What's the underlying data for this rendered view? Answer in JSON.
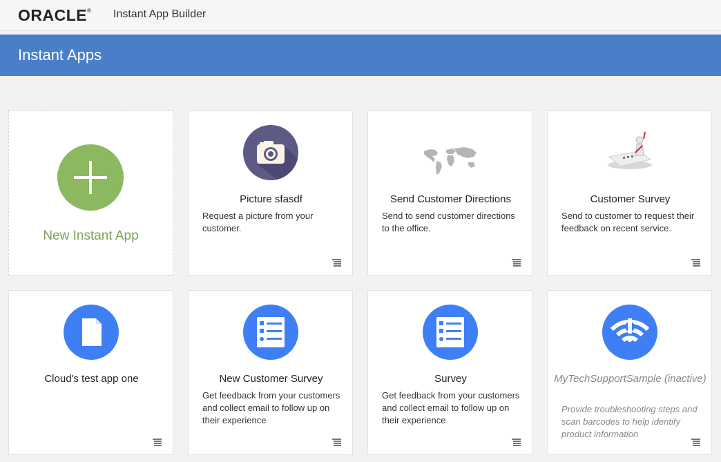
{
  "header": {
    "brand": "ORACLE",
    "brand_mark": "®",
    "app_name": "Instant App Builder"
  },
  "banner": {
    "title": "Instant Apps"
  },
  "new_app": {
    "label": "New Instant App",
    "icon": "plus-icon",
    "color": "#8cb860"
  },
  "apps": [
    {
      "title": "Picture sfasdf",
      "description": "Request a picture from your customer.",
      "icon": "camera-icon",
      "active": true
    },
    {
      "title": "Send Customer Directions",
      "description": "Send to send customer directions to the office.",
      "icon": "world-map-icon",
      "active": true
    },
    {
      "title": "Customer Survey",
      "description": "Send to customer to request their feedback on recent service.",
      "icon": "survey-figure-icon",
      "active": true
    },
    {
      "title": "Cloud's test app one",
      "description": "",
      "icon": "document-icon",
      "active": true
    },
    {
      "title": "New Customer Survey",
      "description": "Get feedback from your customers and collect email to follow up on their experience",
      "icon": "checklist-icon",
      "active": true
    },
    {
      "title": "Survey",
      "description": "Get feedback from your customers and collect email to follow up on their experience",
      "icon": "checklist-icon",
      "active": true
    },
    {
      "title": "MyTechSupportSample (inactive)",
      "description": "Provide troubleshooting steps and scan barcodes to help identify product information",
      "icon": "wifi-alert-icon",
      "active": false
    }
  ],
  "colors": {
    "banner": "#4a7ec9",
    "icon_blue": "#3f7ff5",
    "icon_purple": "#5d5b86"
  }
}
